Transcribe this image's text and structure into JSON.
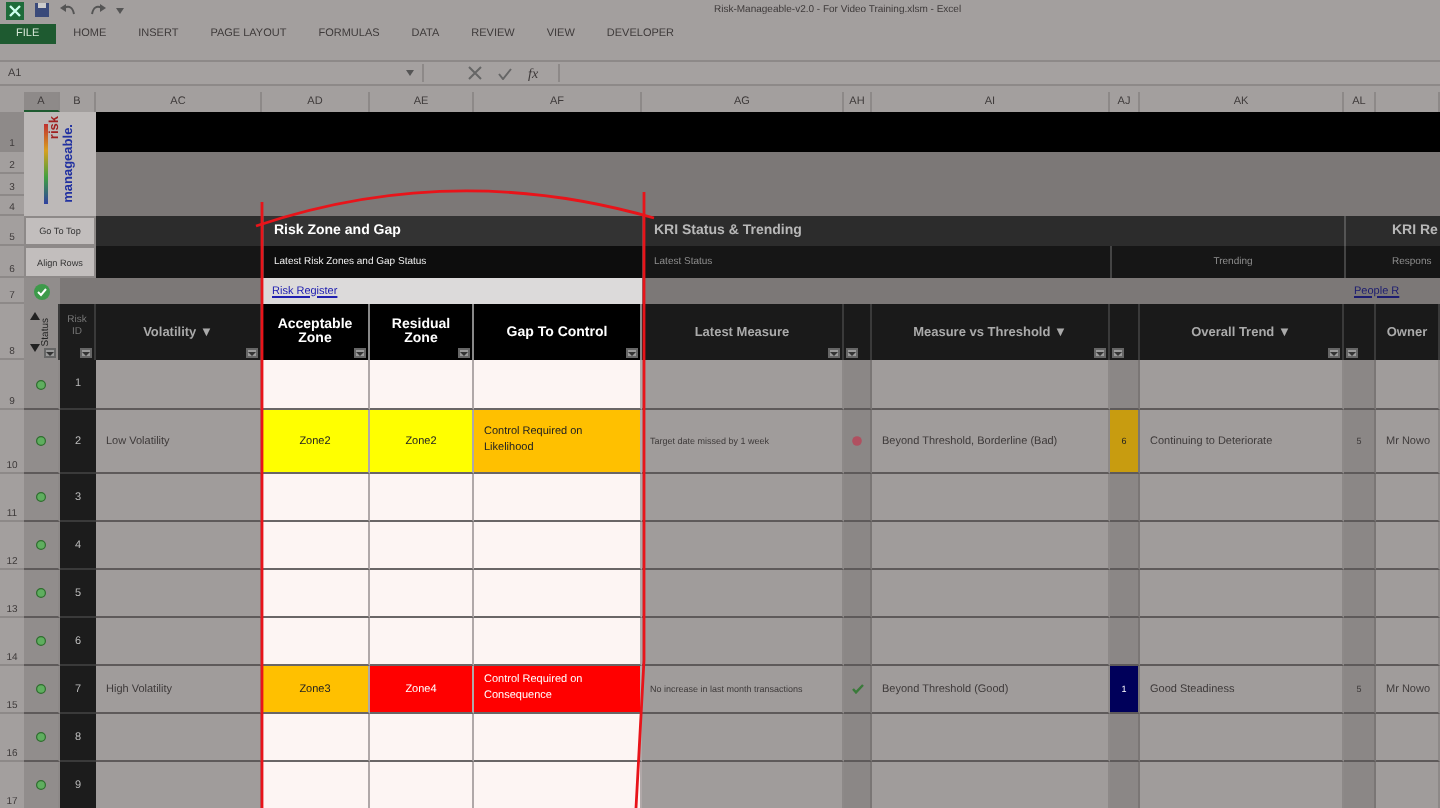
{
  "title_bar": {
    "title": "Risk-Manageable-v2.0 - For Video Training.xlsm - Excel"
  },
  "ribbon_tabs": [
    {
      "label": "FILE",
      "selected": true
    },
    {
      "label": "HOME",
      "selected": false
    },
    {
      "label": "INSERT",
      "selected": false
    },
    {
      "label": "PAGE LAYOUT",
      "selected": false
    },
    {
      "label": "FORMULAS",
      "selected": false
    },
    {
      "label": "DATA",
      "selected": false
    },
    {
      "label": "REVIEW",
      "selected": false
    },
    {
      "label": "VIEW",
      "selected": false
    },
    {
      "label": "DEVELOPER",
      "selected": false
    }
  ],
  "formula_bar": {
    "name_box": "A1",
    "function_label": "fx"
  },
  "column_headers": [
    {
      "label": "A",
      "selected": true
    },
    {
      "label": "B",
      "selected": false
    },
    {
      "label": "AC",
      "selected": false
    },
    {
      "label": "AD",
      "selected": false
    },
    {
      "label": "AE",
      "selected": false
    },
    {
      "label": "AF",
      "selected": false
    },
    {
      "label": "AG",
      "selected": false
    },
    {
      "label": "AH",
      "selected": false
    },
    {
      "label": "AI",
      "selected": false
    },
    {
      "label": "AJ",
      "selected": false
    },
    {
      "label": "AK",
      "selected": false
    },
    {
      "label": "AL",
      "selected": false
    }
  ],
  "row_numbers": [
    {
      "label": "1",
      "selected": true
    },
    {
      "label": "2",
      "selected": false
    },
    {
      "label": "3",
      "selected": false
    },
    {
      "label": "4",
      "selected": false
    },
    {
      "label": "5",
      "selected": false
    },
    {
      "label": "6",
      "selected": false
    },
    {
      "label": "7",
      "selected": false
    },
    {
      "label": "8",
      "selected": false
    },
    {
      "label": "9",
      "selected": false
    },
    {
      "label": "10",
      "selected": false
    },
    {
      "label": "11",
      "selected": false
    },
    {
      "label": "12",
      "selected": false
    },
    {
      "label": "13",
      "selected": false
    },
    {
      "label": "14",
      "selected": false
    },
    {
      "label": "15",
      "selected": false
    },
    {
      "label": "16",
      "selected": false
    },
    {
      "label": "17",
      "selected": false
    }
  ],
  "logo": {
    "words": [
      "risk",
      "manageable."
    ]
  },
  "sheet_buttons": [
    "Go To Top",
    "Align Rows"
  ],
  "sections": [
    {
      "title": "Risk Zone and Gap",
      "subtitles": [
        "Latest Risk Zones and Gap Status"
      ],
      "link": "Risk Register"
    },
    {
      "title": "KRI Status & Trending",
      "subtitles": [
        "Latest Status",
        "Trending"
      ]
    },
    {
      "title": "KRI Re",
      "subtitles": [
        "Respons"
      ],
      "link": "People R"
    }
  ],
  "columns": [
    {
      "label": "Status",
      "kind": "status",
      "filter": true
    },
    {
      "label": "Risk ID",
      "kind": "id",
      "filter": true
    },
    {
      "label": "Volatility ▼",
      "kind": "dim",
      "filter": true
    },
    {
      "label": "Acceptable Zone",
      "kind": "bright",
      "filter": true
    },
    {
      "label": "Residual Zone",
      "kind": "bright",
      "filter": true
    },
    {
      "label": "Gap To Control",
      "kind": "bright",
      "filter": true
    },
    {
      "label": "Latest Measure",
      "kind": "dim",
      "filter": true
    },
    {
      "kind": "narrow",
      "filter": true
    },
    {
      "label": "Measure vs Threshold ▼",
      "kind": "dim",
      "filter": true
    },
    {
      "kind": "narrow",
      "filter": true
    },
    {
      "label": "Overall Trend ▼",
      "kind": "dim",
      "filter": true
    },
    {
      "kind": "narrow",
      "filter": true
    },
    {
      "label": "Owner",
      "kind": "dim",
      "filter": false
    }
  ],
  "rows": [
    {
      "id": "1"
    },
    {
      "id": "2",
      "volatility": "Low Volatility",
      "acceptable_zone": {
        "text": "Zone2",
        "color": "#ffff00"
      },
      "residual_zone": {
        "text": "Zone2",
        "color": "#ffff00"
      },
      "gap": {
        "text": "Control Required on Likelihood",
        "color": "#ffc000"
      },
      "latest_measure": "Target date missed by 1 week",
      "threshold_alert": true,
      "threshold": "Beyond Threshold, Borderline (Bad)",
      "trend_score": {
        "text": "6",
        "color": "#c89c10"
      },
      "trend": "Continuing to Deteriorate",
      "response_score": "5",
      "owner": "Mr Nowo"
    },
    {
      "id": "3"
    },
    {
      "id": "4"
    },
    {
      "id": "5"
    },
    {
      "id": "6"
    },
    {
      "id": "7",
      "volatility": "High Volatility",
      "acceptable_zone": {
        "text": "Zone3",
        "color": "#ffc000"
      },
      "residual_zone": {
        "text": "Zone4",
        "color": "#ff0000"
      },
      "gap": {
        "text": "Control Required on Consequence",
        "color": "#ff0000"
      },
      "latest_measure": "No increase in last month transactions",
      "threshold_alert": false,
      "threshold": "Beyond Threshold (Good)",
      "trend_score": {
        "text": "1",
        "color": "#00005a"
      },
      "trend": "Good Steadiness",
      "response_score": "5",
      "owner": "Mr Nowo"
    },
    {
      "id": "8"
    },
    {
      "id": "9"
    }
  ]
}
